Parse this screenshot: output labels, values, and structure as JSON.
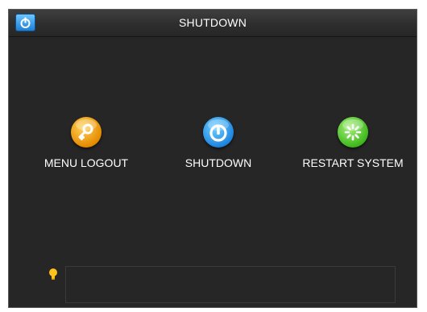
{
  "window": {
    "title": "SHUTDOWN",
    "title_icon": "power-icon"
  },
  "actions": [
    {
      "label": "MENU LOGOUT",
      "icon": "key-icon",
      "color": "#F5A200"
    },
    {
      "label": "SHUTDOWN",
      "icon": "power-icon",
      "color": "#1F86E0"
    },
    {
      "label": "RESTART SYSTEM",
      "icon": "restart-icon",
      "color": "#3FB81C"
    }
  ],
  "tip": {
    "icon": "lightbulb-icon",
    "text": ""
  }
}
